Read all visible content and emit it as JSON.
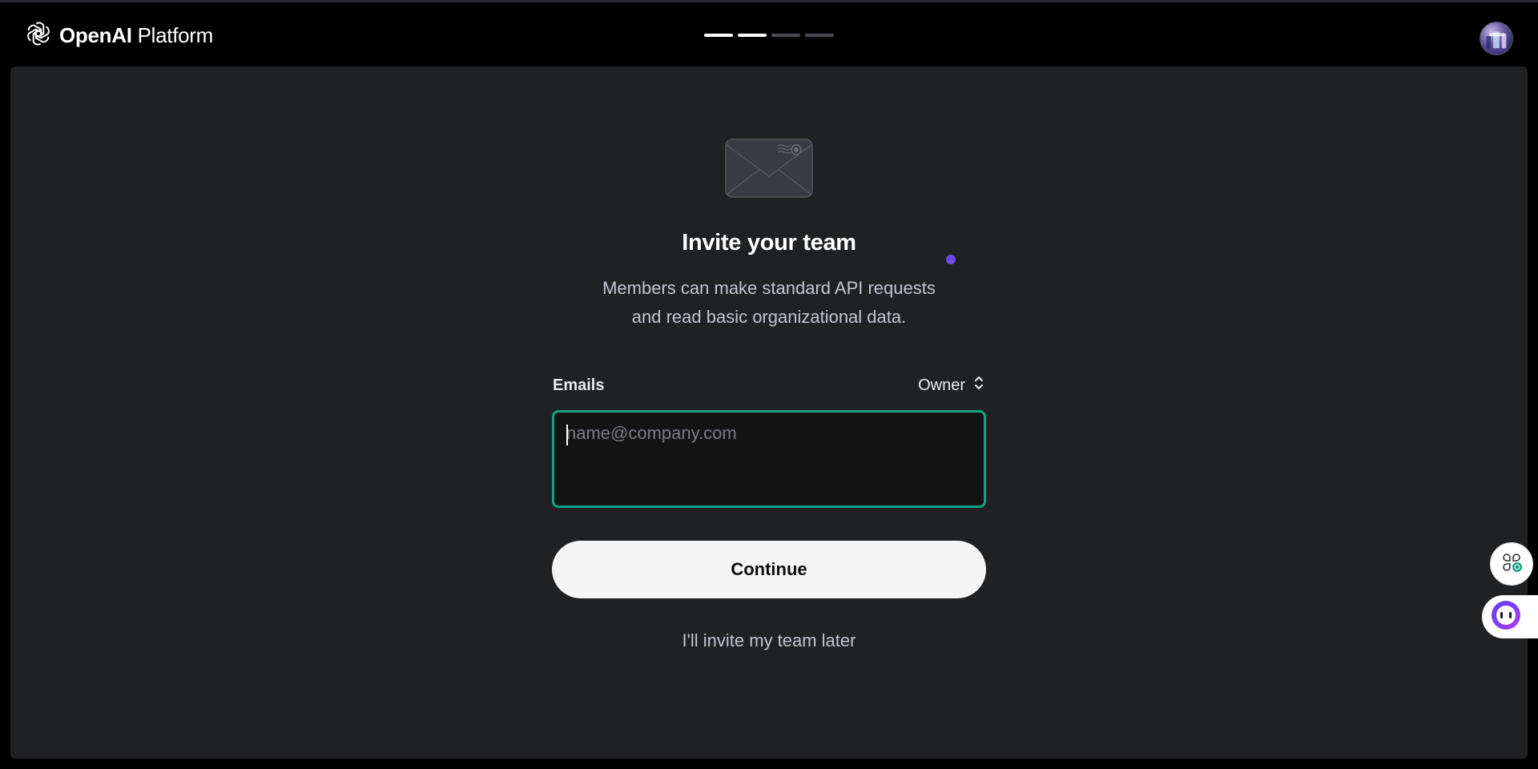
{
  "header": {
    "brand_bold": "OpenAI",
    "brand_light": "Platform",
    "progress_steps_total": 4,
    "progress_steps_done": 2
  },
  "main": {
    "title": "Invite your team",
    "subtitle_line1": "Members can make standard API requests",
    "subtitle_line2": "and read basic organizational data.",
    "emails_label": "Emails",
    "role_value": "Owner",
    "email_placeholder": "name@company.com",
    "email_value": "",
    "continue_label": "Continue",
    "later_label": "I'll invite my team later"
  },
  "icons": {
    "logo": "openai-logo-icon",
    "envelope": "envelope-icon",
    "role_chevron": "chevron-up-down-icon",
    "avatar": "avatar",
    "float_1": "shortcut-icon",
    "float_2": "assistant-face-icon"
  },
  "colors": {
    "accent_focus": "#10a37f",
    "panel_bg": "#202123",
    "page_bg": "#000000",
    "progress_done": "#ffffff",
    "progress_todo": "#4a4b55",
    "dot": "#6e4ae8"
  }
}
